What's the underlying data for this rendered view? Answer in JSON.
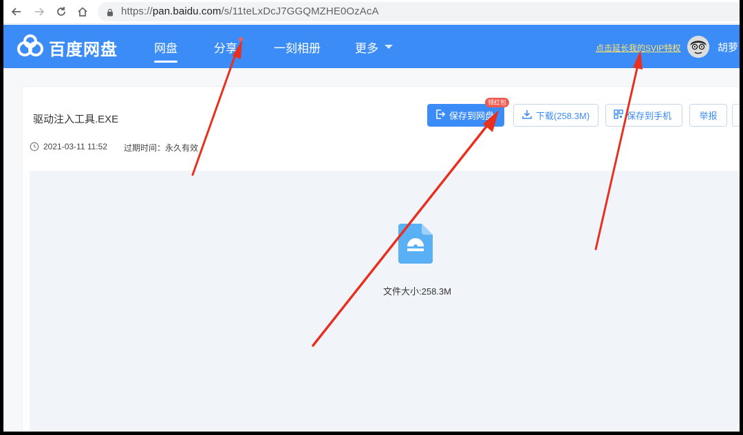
{
  "browser": {
    "url_prefix": "https://",
    "url_host": "pan.baidu.com",
    "url_path": "/s/11teLxDcJ7GGQMZHE0OzAcA"
  },
  "header": {
    "logo_text": "百度网盘",
    "nav": [
      "网盘",
      "分享",
      "一刻相册",
      "更多"
    ],
    "svip_link": "点击延长我的SVIP特权",
    "username": "胡萝"
  },
  "file": {
    "title": "驱动注入工具.EXE",
    "share_time": "2021-03-11 11:52",
    "expire_label": "过期时间：永久有效",
    "size_label": "文件大小:258.3M"
  },
  "actions": {
    "save_label": "保存到网盘",
    "save_badge": "领红包",
    "download_label": "下载(258.3M)",
    "phone_label": "保存到手机",
    "report_label": "举报"
  },
  "colors": {
    "brand_blue": "#3b8cf7",
    "svip_yellow": "#ffe270",
    "badge_red": "#f05a4e",
    "annotation_red": "#e8301f"
  },
  "icons": {
    "back": "arrow-left-icon",
    "forward": "arrow-right-icon",
    "reload": "reload-icon",
    "home": "home-icon",
    "lock": "lock-icon",
    "logo": "cloud-logo-icon",
    "clock": "clock-icon",
    "file": "exe-file-icon"
  }
}
